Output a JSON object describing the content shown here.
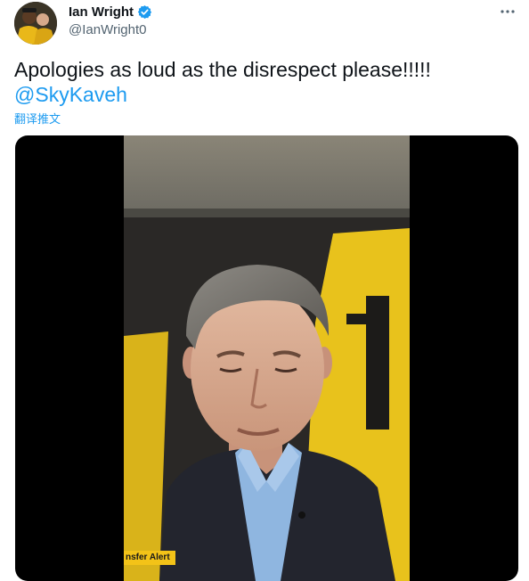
{
  "author": {
    "display_name": "Ian Wright",
    "handle": "@IanWright0",
    "verified_icon": "verified-badge-icon",
    "avatar_icon": "user-avatar"
  },
  "tweet": {
    "text": "Apologies as loud as the disrespect please!!!!!",
    "mention": "@SkyKaveh",
    "translate_label": "翻译推文"
  },
  "menu": {
    "icon": "more-horizontal-icon"
  },
  "media": {
    "type": "video",
    "lower_third_text": "nsfer Alert"
  },
  "colors": {
    "link": "#1d9bf0",
    "text": "#0f1419",
    "secondary": "#536471",
    "broadcast_yellow": "#f3c318"
  }
}
